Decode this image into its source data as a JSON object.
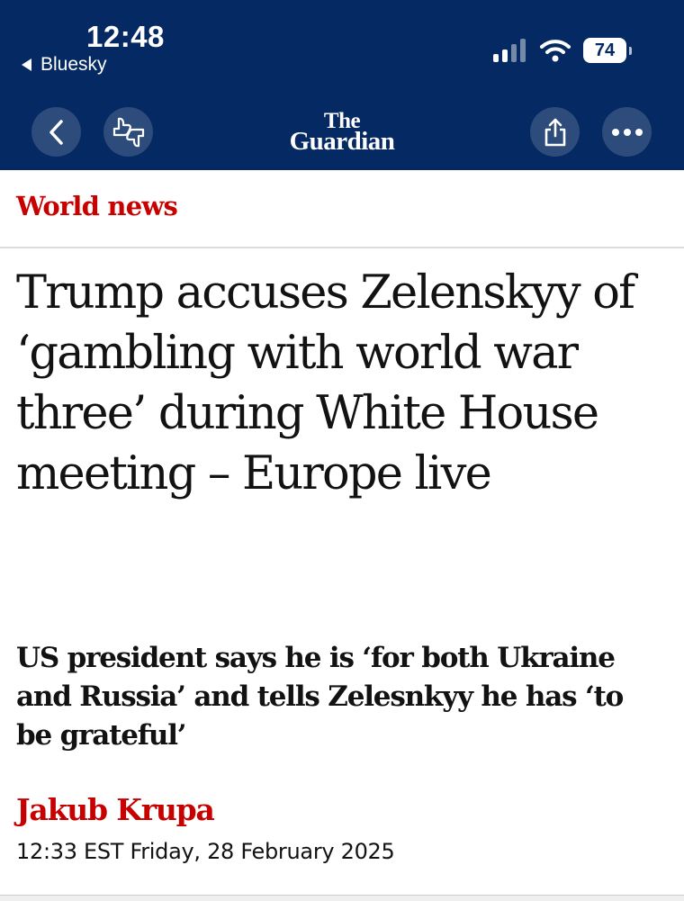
{
  "status_bar": {
    "time": "12:48",
    "back_app": "Bluesky",
    "battery": "74"
  },
  "toolbar": {
    "logo_line1": "The",
    "logo_line2": "Guardian",
    "icons": [
      "back-icon",
      "thumbs-feedback-icon",
      "share-icon",
      "more-icon"
    ]
  },
  "article": {
    "section": "World news",
    "headline": "Trump accuses Zelenskyy of ‘gambling with world war three’ during White House meeting – Europe live",
    "standfirst": "US president says he is ‘for both Ukraine and Russia’ and tells Zelesnkyy he has ‘to be grateful’",
    "author": "Jakub Krupa",
    "dateline": "12:33 EST Friday, 28 February 2025"
  },
  "colors": {
    "brand_navy": "#052962",
    "section_red": "#c70000",
    "text": "#121212"
  }
}
